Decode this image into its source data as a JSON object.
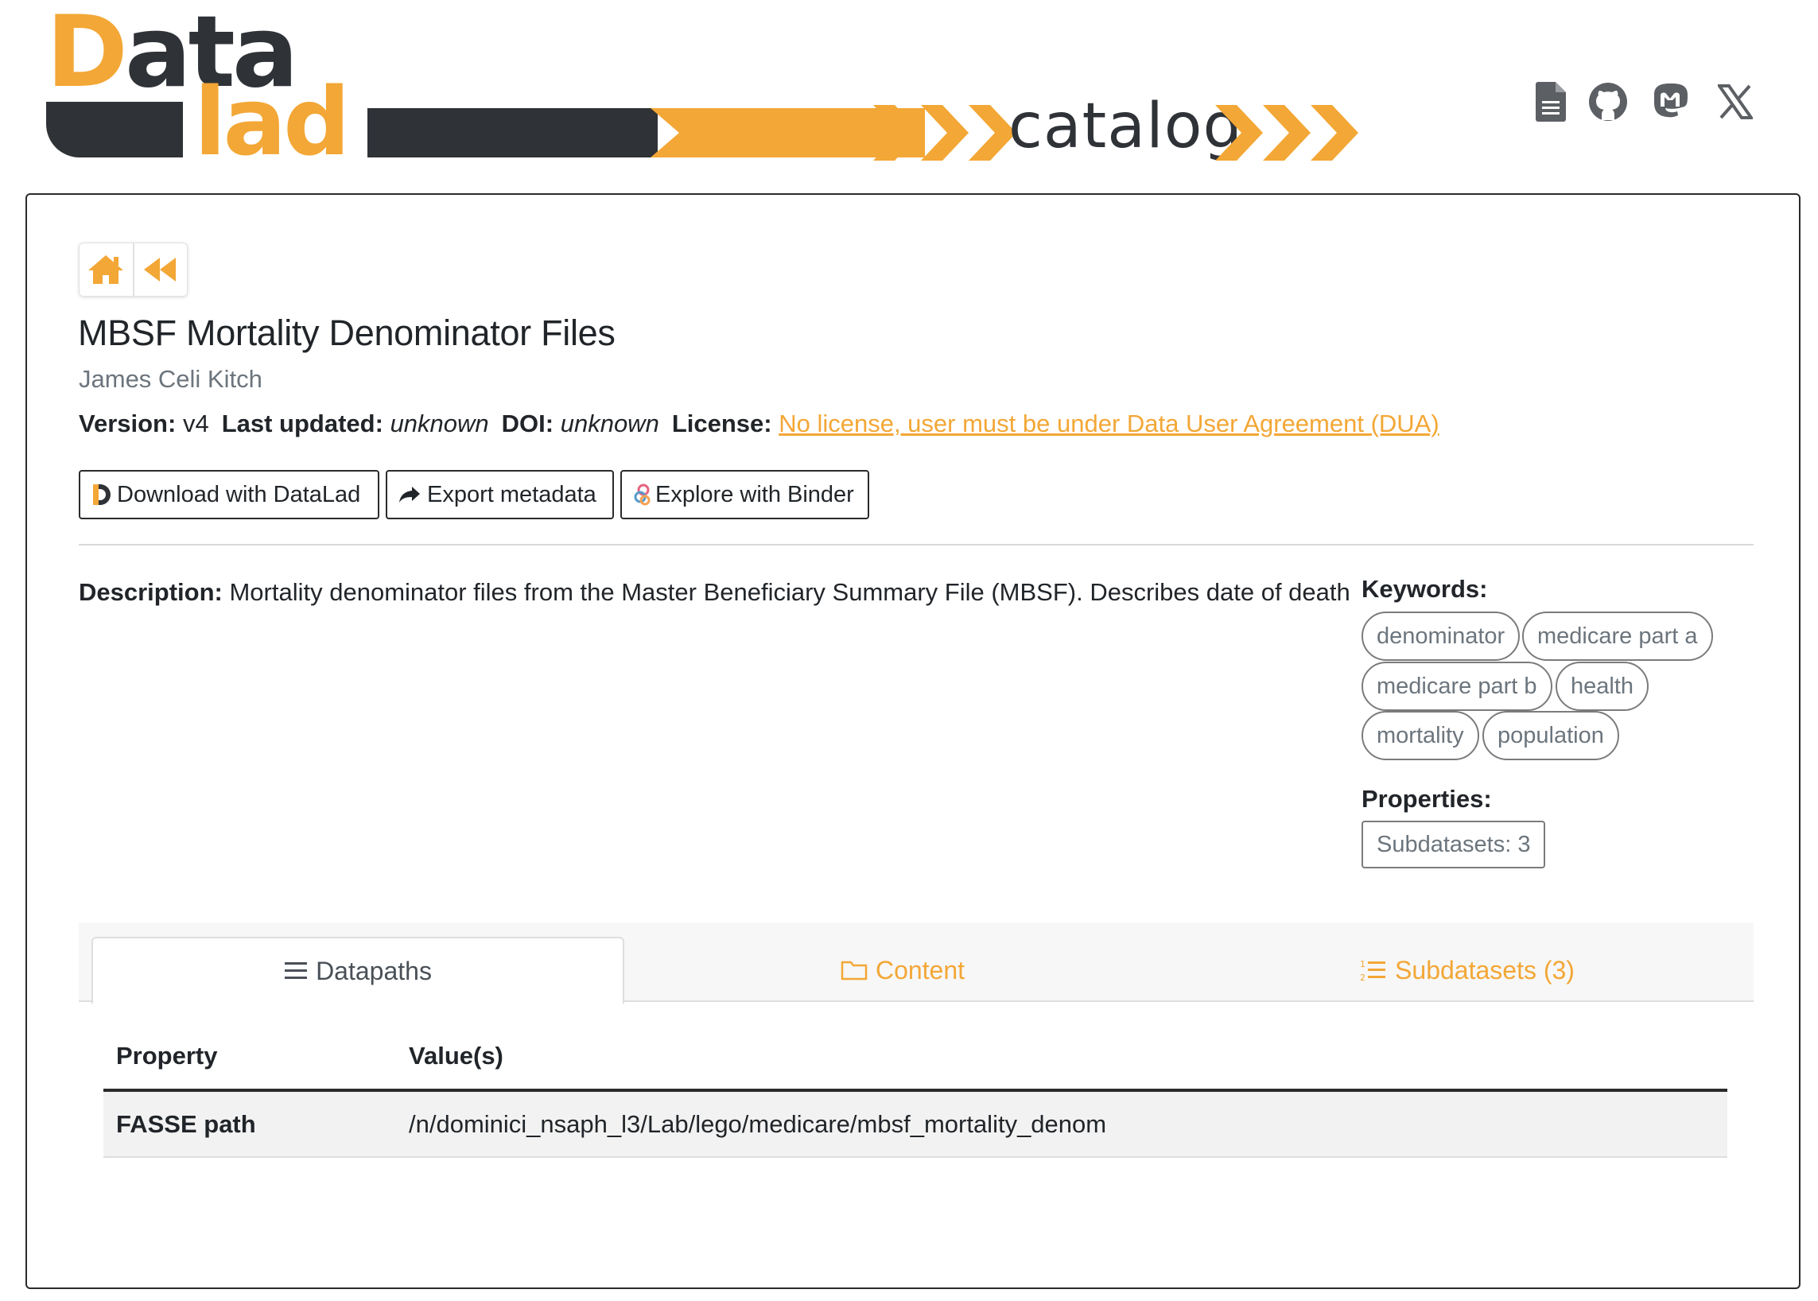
{
  "header": {
    "logo_data_first": "D",
    "logo_data_rest": "ata",
    "logo_lad": "lad",
    "logo_catalog": "catalog",
    "icons": [
      "document-icon",
      "github-icon",
      "mastodon-icon",
      "x-icon"
    ]
  },
  "nav": {
    "home_icon": "home-icon",
    "back_icon": "backward-icon"
  },
  "dataset": {
    "title": "MBSF Mortality Denominator Files",
    "author": "James Celi Kitch",
    "version_label": "Version:",
    "version": "v4",
    "updated_label": "Last updated:",
    "updated": "unknown",
    "doi_label": "DOI:",
    "doi": "unknown",
    "license_label": "License:",
    "license": "No license, user must be under Data User Agreement (DUA)"
  },
  "actions": {
    "download": "Download with DataLad",
    "export": "Export metadata",
    "binder": "Explore with Binder"
  },
  "description": {
    "label": "Description:",
    "text": "Mortality denominator files from the Master Beneficiary Summary File (MBSF). Describes date of death"
  },
  "keywords": {
    "label": "Keywords:",
    "items": [
      "denominator",
      "medicare part a",
      "medicare part b",
      "health",
      "mortality",
      "population"
    ]
  },
  "properties": {
    "label": "Properties:",
    "subdatasets": "Subdatasets: 3"
  },
  "tabs": [
    {
      "label": "Datapaths",
      "icon": "list-icon",
      "active": true
    },
    {
      "label": "Content",
      "icon": "folder-icon",
      "active": false
    },
    {
      "label": "Subdatasets (3)",
      "icon": "ordered-list-icon",
      "active": false
    }
  ],
  "table": {
    "headers": [
      "Property",
      "Value(s)"
    ],
    "rows": [
      {
        "property": "FASSE path",
        "value": "/n/dominici_nsaph_l3/Lab/lego/medicare/mbsf_mortality_denom"
      }
    ]
  },
  "colors": {
    "accent": "#f3a736",
    "dark": "#2f3237",
    "muted": "#6c757d"
  }
}
